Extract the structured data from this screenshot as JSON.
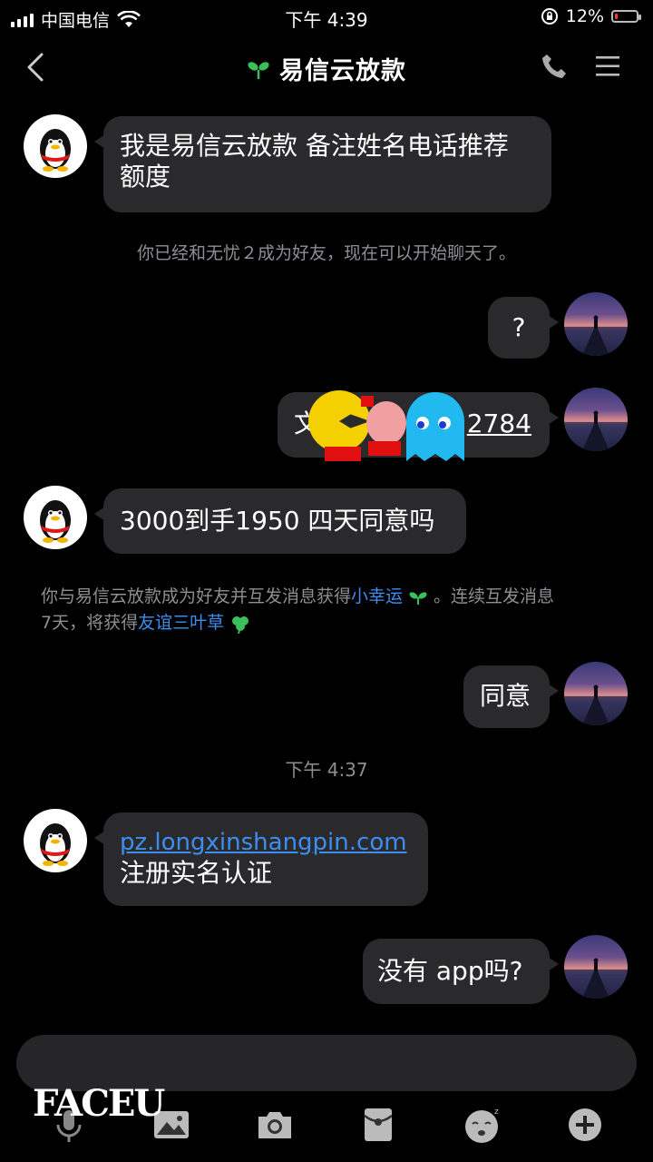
{
  "status_bar": {
    "carrier": "中国电信",
    "time": "下午 4:39",
    "battery": "12%",
    "battery_level": 0.12
  },
  "header": {
    "title": "易信云放款"
  },
  "messages": {
    "m1": "我是易信云放款 备注姓名电话推荐",
    "m1b": "额度",
    "sys1": "你已经和无忧２成为好友，现在可以开始聊天了。",
    "m2": "?",
    "m3_start": "文件",
    "m3_end": "2784",
    "m4": "3000到手1950 四天同意吗",
    "sys2_a": "你与易信云放款成为好友并互发消息获得",
    "sys2_link1": "小幸运",
    "sys2_b": "。连续互发消息",
    "sys2_c": "7天，将获得",
    "sys2_link2": "友谊三叶草",
    "m5": "同意",
    "timestamp": "下午 4:37",
    "m6_link": "pz.longxinshangpin.com",
    "m6_text": "注册实名认证",
    "m7": "没有 app吗?"
  },
  "watermark": "FACEU",
  "icons": [
    "back-icon",
    "sprout-icon",
    "phone-icon",
    "menu-icon",
    "mic-icon",
    "image-icon",
    "camera-icon",
    "red-packet-icon",
    "emoji-icon",
    "plus-icon"
  ]
}
